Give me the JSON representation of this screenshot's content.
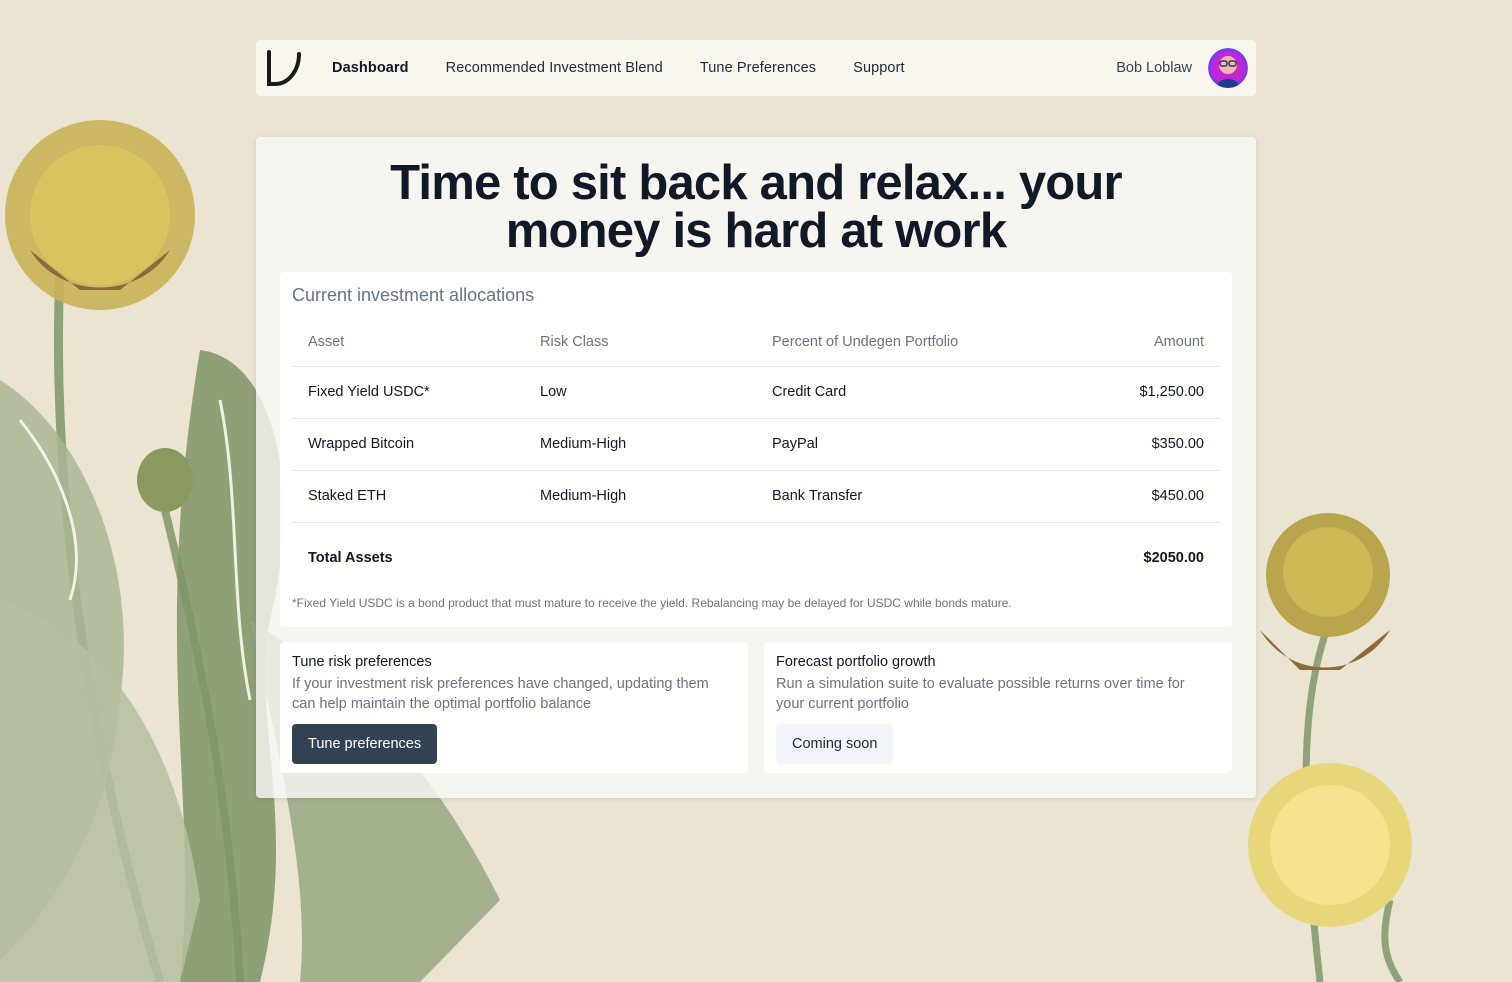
{
  "nav": {
    "logo_icon": "undegen-logo-icon",
    "links": [
      {
        "label": "Dashboard",
        "active": true
      },
      {
        "label": "Recommended Investment Blend",
        "active": false
      },
      {
        "label": "Tune Preferences",
        "active": false
      },
      {
        "label": "Support",
        "active": false
      }
    ],
    "user_name": "Bob Loblaw",
    "avatar_icon": "user-avatar"
  },
  "headline": {
    "line1": "Time to sit back and relax... your",
    "line2": "money is hard at work"
  },
  "allocations": {
    "title": "Current investment allocations",
    "columns": [
      "Asset",
      "Risk Class",
      "Percent of Undegen Portfolio",
      "Amount"
    ],
    "rows": [
      {
        "asset": "Fixed Yield USDC*",
        "risk": "Low",
        "percent": "Credit Card",
        "amount": "$1,250.00"
      },
      {
        "asset": "Wrapped Bitcoin",
        "risk": "Medium-High",
        "percent": "PayPal",
        "amount": "$350.00"
      },
      {
        "asset": "Staked ETH",
        "risk": "Medium-High",
        "percent": "Bank Transfer",
        "amount": "$450.00"
      }
    ],
    "total_label": "Total Assets",
    "total_amount": "$2050.00",
    "footnote": "*Fixed Yield USDC is a bond product that must mature to receive the yield. Rebalancing may be delayed for USDC while bonds mature."
  },
  "panels": {
    "tune": {
      "title": "Tune risk preferences",
      "description": "If your investment risk preferences have changed, updating them can help maintain the optimal portfolio balance",
      "button": "Tune preferences"
    },
    "forecast": {
      "title": "Forecast portfolio growth",
      "description": "Run a simulation suite to evaluate possible returns over time for your current portfolio",
      "button": "Coming soon"
    }
  },
  "colors": {
    "background": "#ebe4d2",
    "primary_button": "#334155",
    "secondary_button": "#f1f5f9",
    "heading": "#111827",
    "muted": "#6b7280"
  }
}
